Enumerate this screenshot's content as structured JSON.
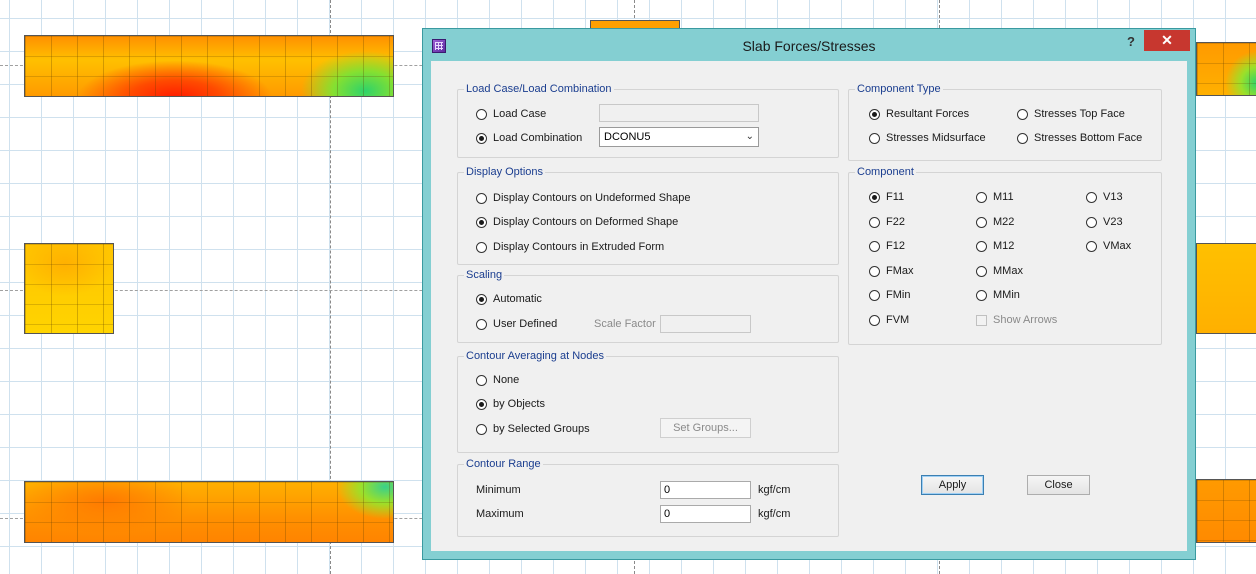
{
  "dialog": {
    "title": "Slab Forces/Stresses",
    "help_label": "?",
    "close_glyph": "✕"
  },
  "load_case": {
    "group_title": "Load Case/Load Combination",
    "load_case_label": "Load Case",
    "load_case_value": "",
    "load_combination_label": "Load Combination",
    "load_combination_value": "DCONU5",
    "selected": "Load Combination"
  },
  "display_options": {
    "group_title": "Display Options",
    "items": [
      "Display Contours on Undeformed Shape",
      "Display Contours on Deformed Shape",
      "Display Contours in Extruded Form"
    ],
    "selected": "Display Contours on Deformed Shape"
  },
  "scaling": {
    "group_title": "Scaling",
    "automatic_label": "Automatic",
    "user_defined_label": "User Defined",
    "scale_factor_label": "Scale Factor",
    "scale_factor_value": "",
    "selected": "Automatic"
  },
  "contour_averaging": {
    "group_title": "Contour Averaging at Nodes",
    "items": [
      "None",
      "by Objects",
      "by Selected Groups"
    ],
    "selected": "by Objects",
    "set_groups_label": "Set Groups..."
  },
  "contour_range": {
    "group_title": "Contour Range",
    "minimum_label": "Minimum",
    "minimum_value": "0",
    "maximum_label": "Maximum",
    "maximum_value": "0",
    "unit": "kgf/cm"
  },
  "component_type": {
    "group_title": "Component Type",
    "items": [
      "Resultant Forces",
      "Stresses Top Face",
      "Stresses Midsurface",
      "Stresses Bottom Face"
    ],
    "selected": "Resultant Forces"
  },
  "component": {
    "group_title": "Component",
    "col1": [
      "F11",
      "F22",
      "F12",
      "FMax",
      "FMin",
      "FVM"
    ],
    "col2": [
      "M11",
      "M22",
      "M12",
      "MMax",
      "MMin"
    ],
    "col3": [
      "V13",
      "V23",
      "VMax"
    ],
    "selected": "F11",
    "show_arrows_label": "Show Arrows"
  },
  "buttons": {
    "apply": "Apply",
    "close": "Close"
  }
}
